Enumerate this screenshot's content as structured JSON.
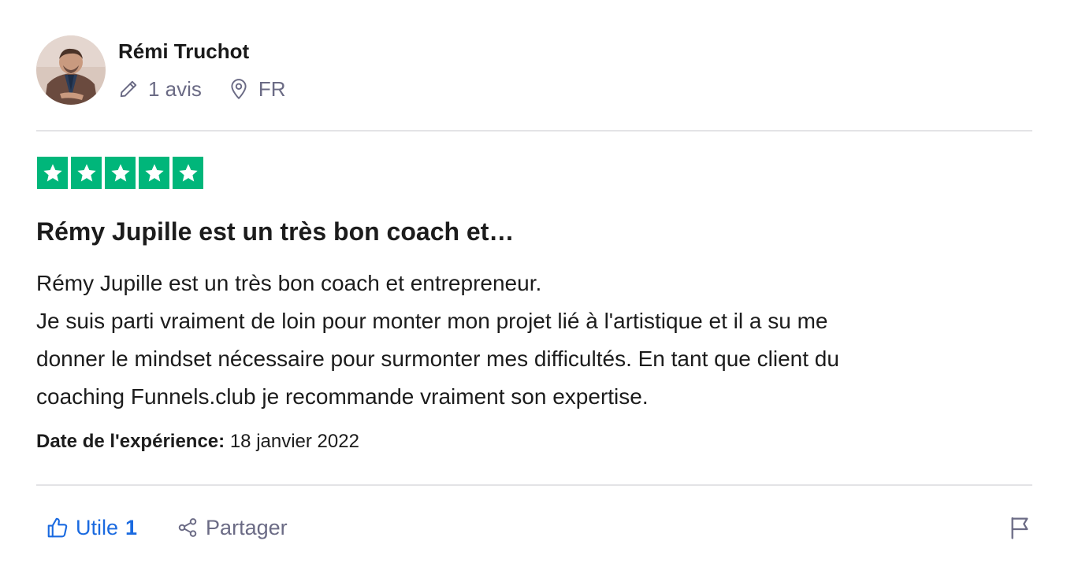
{
  "reviewer": {
    "name": "Rémi Truchot",
    "avatar_icon": "user-photo",
    "reviews_count_label": "1 avis",
    "country": "FR",
    "pencil_icon": "pencil-icon",
    "location_icon": "location-pin-icon"
  },
  "rating": {
    "stars": 5,
    "max": 5,
    "color": "#00b67a"
  },
  "review": {
    "title": "Rémy Jupille est un très bon coach et…",
    "body_lines": [
      "Rémy Jupille est un très bon coach et entrepreneur.",
      "Je suis parti vraiment de loin pour monter mon projet lié à l'artistique et il a su me",
      "donner le mindset nécessaire pour surmonter mes difficultés. En tant que client du",
      "coaching Funnels.club je recommande vraiment son expertise."
    ],
    "experience_label": "Date de l'expérience:",
    "experience_date": "18 janvier 2022"
  },
  "actions": {
    "useful_label": "Utile",
    "useful_count": "1",
    "share_label": "Partager",
    "useful_color": "#1a6ae0",
    "muted_color": "#6b6b85",
    "flag_icon": "flag-icon"
  }
}
